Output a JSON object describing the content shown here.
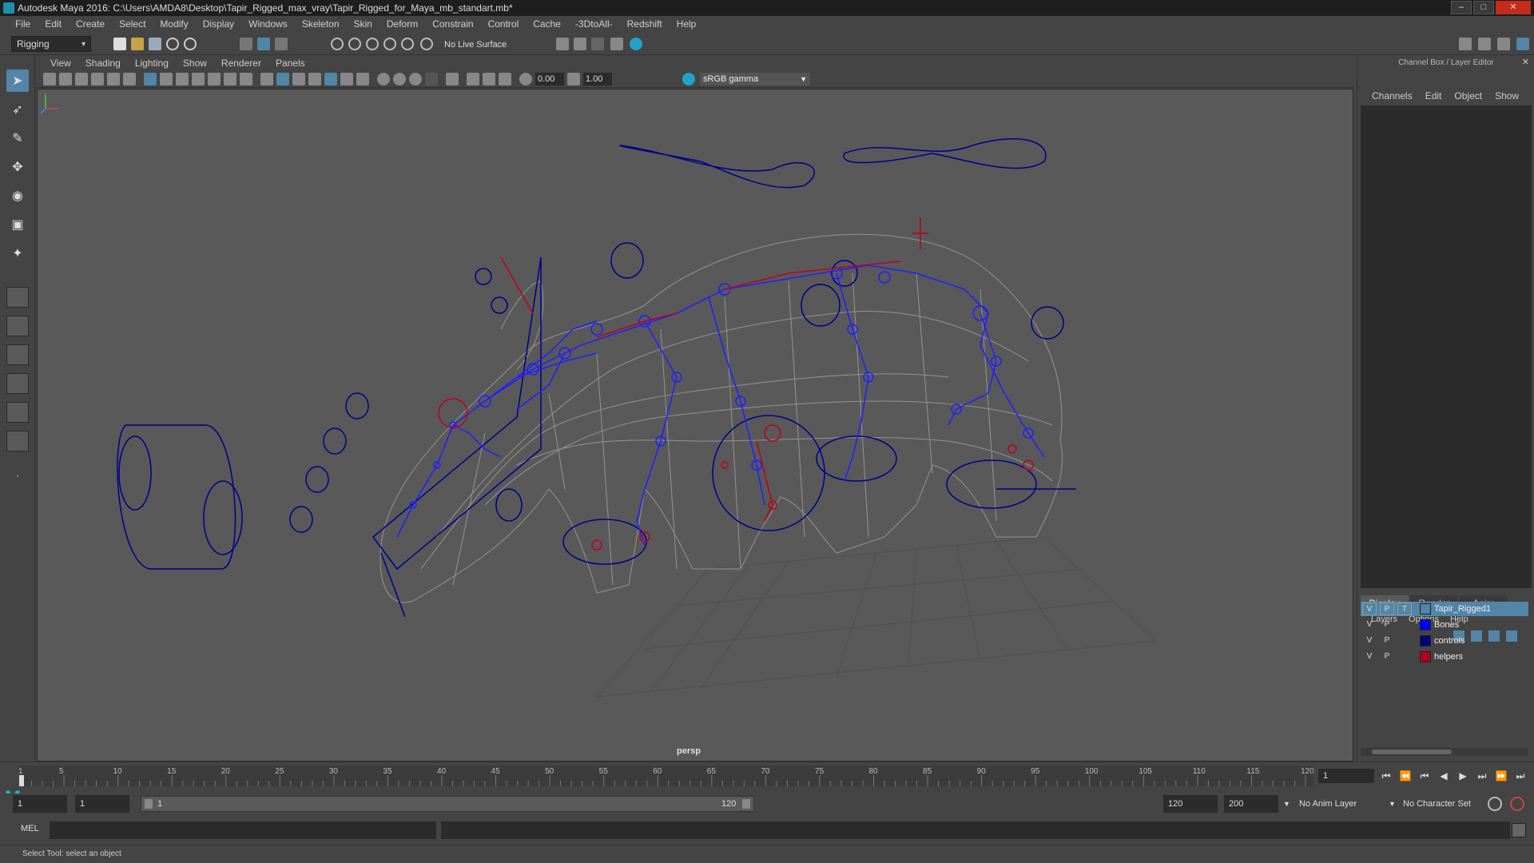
{
  "window": {
    "title": "Autodesk Maya 2016: C:\\Users\\AMDA8\\Desktop\\Tapir_Rigged_max_vray\\Tapir_Rigged_for_Maya_mb_standart.mb*"
  },
  "menubar": [
    "File",
    "Edit",
    "Create",
    "Select",
    "Modify",
    "Display",
    "Windows",
    "Skeleton",
    "Skin",
    "Deform",
    "Constrain",
    "Control",
    "Cache",
    "-3DtoAll-",
    "Redshift",
    "Help"
  ],
  "statusline": {
    "mode": "Rigging",
    "live_surface": "No Live Surface"
  },
  "panel": {
    "menus": [
      "View",
      "Shading",
      "Lighting",
      "Show",
      "Renderer",
      "Panels"
    ],
    "exposure": "0.00",
    "gamma": "1.00",
    "color_space": "sRGB gamma",
    "camera_label": "persp"
  },
  "right_panel": {
    "title": "Channel Box / Layer Editor",
    "channel_menus": [
      "Channels",
      "Edit",
      "Object",
      "Show"
    ],
    "tabs": [
      "Display",
      "Render",
      "Anim"
    ],
    "layer_menus": [
      "Layers",
      "Options",
      "Help"
    ],
    "layers": [
      {
        "v": "V",
        "p": "P",
        "t": "T",
        "name": "Tapir_Rigged1",
        "color": "#5285a6",
        "selected": true
      },
      {
        "v": "V",
        "p": "P",
        "t": "",
        "name": "Bones",
        "color": "#0000ff",
        "selected": false
      },
      {
        "v": "V",
        "p": "P",
        "t": "",
        "name": "controls",
        "color": "#00007a",
        "selected": false
      },
      {
        "v": "V",
        "p": "P",
        "t": "",
        "name": "helpers",
        "color": "#b0001c",
        "selected": false
      }
    ]
  },
  "timeslider": {
    "ticks": [
      "1",
      "5",
      "10",
      "15",
      "20",
      "25",
      "30",
      "35",
      "40",
      "45",
      "50",
      "55",
      "60",
      "65",
      "70",
      "75",
      "80",
      "85",
      "90",
      "95",
      "100",
      "105",
      "110",
      "115",
      "120"
    ],
    "current_frame": "1",
    "playback": [
      "⏮",
      "⏪",
      "⏮",
      "◀",
      "▶",
      "⏭",
      "⏩",
      "⏭"
    ]
  },
  "rangeslider": {
    "start": "1",
    "playback_start": "1",
    "bar_start": "1",
    "bar_end": "120",
    "playback_end": "120",
    "end": "200",
    "anim_layer": "No Anim Layer",
    "character_set": "No Character Set"
  },
  "cmdline": {
    "label": "MEL"
  },
  "helpline": {
    "text": "Select Tool: select an object"
  },
  "colors": {
    "bone": "#2020ff",
    "control": "#00008b",
    "helper": "#c00020",
    "mesh": "#9a9a9a",
    "viewport": "#595959",
    "accent": "#5285a6"
  }
}
